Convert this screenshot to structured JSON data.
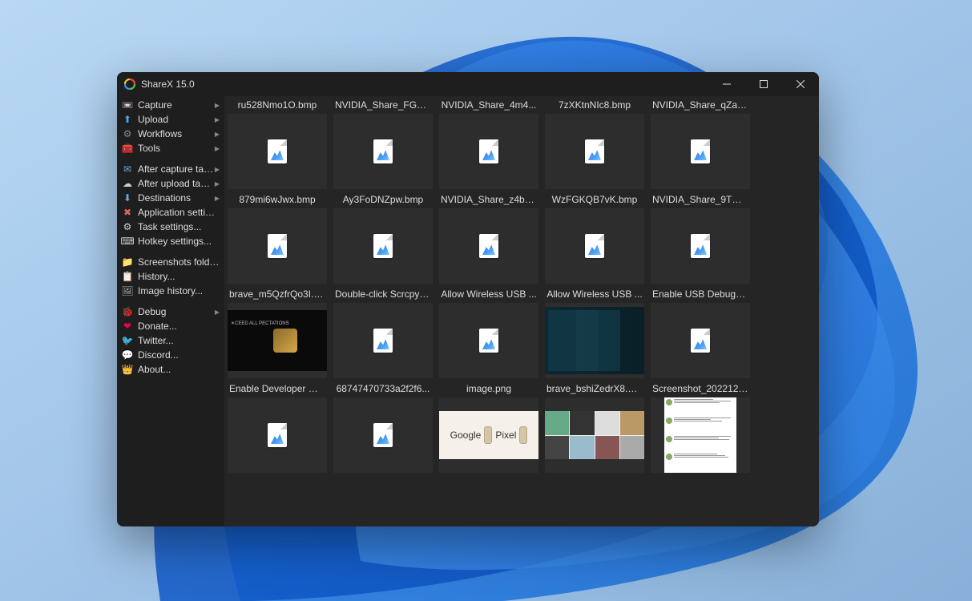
{
  "window": {
    "title": "ShareX 15.0"
  },
  "titlebar": {
    "minimize": "—",
    "maximize": "▢",
    "close": "✕"
  },
  "sidebar": {
    "items": [
      {
        "icon": "📼",
        "label": "Capture",
        "arrow": true
      },
      {
        "icon": "⬆",
        "label": "Upload",
        "arrow": true,
        "iconColor": "#4aa3ff"
      },
      {
        "icon": "⚙",
        "label": "Workflows",
        "arrow": true,
        "iconColor": "#888"
      },
      {
        "icon": "🧰",
        "label": "Tools",
        "arrow": true,
        "iconColor": "#d44"
      },
      {
        "sep": true
      },
      {
        "icon": "✉",
        "label": "After capture tasks",
        "arrow": true,
        "iconColor": "#6ad"
      },
      {
        "icon": "☁",
        "label": "After upload tasks",
        "arrow": true,
        "iconColor": "#ccc"
      },
      {
        "icon": "⬇",
        "label": "Destinations",
        "arrow": true,
        "iconColor": "#6ad"
      },
      {
        "icon": "✖",
        "label": "Application settings...",
        "iconColor": "#d66"
      },
      {
        "icon": "⚙",
        "label": "Task settings...",
        "iconColor": "#ccc"
      },
      {
        "icon": "⌨",
        "label": "Hotkey settings...",
        "iconColor": "#ccc"
      },
      {
        "sep": true
      },
      {
        "icon": "📁",
        "label": "Screenshots folder...",
        "iconColor": "#e8c060"
      },
      {
        "icon": "📋",
        "label": "History...",
        "iconColor": "#aaa"
      },
      {
        "icon": "🖼",
        "label": "Image history...",
        "iconColor": "#aaa"
      },
      {
        "sep": true
      },
      {
        "icon": "🐞",
        "label": "Debug",
        "arrow": true,
        "iconColor": "#c44"
      },
      {
        "icon": "❤",
        "label": "Donate...",
        "iconColor": "#e05"
      },
      {
        "icon": "🐦",
        "label": "Twitter...",
        "iconColor": "#4ab3ff"
      },
      {
        "icon": "💬",
        "label": "Discord...",
        "iconColor": "#7289da"
      },
      {
        "icon": "👑",
        "label": "About...",
        "iconColor": "#e8c060"
      }
    ]
  },
  "files": [
    {
      "name": "ru528Nmo1O.bmp",
      "kind": "placeholder"
    },
    {
      "name": "NVIDIA_Share_FGO...",
      "kind": "placeholder"
    },
    {
      "name": "NVIDIA_Share_4m4...",
      "kind": "placeholder"
    },
    {
      "name": "7zXKtnNIc8.bmp",
      "kind": "placeholder"
    },
    {
      "name": "NVIDIA_Share_qZa6...",
      "kind": "placeholder"
    },
    {
      "name": "879mi6wJwx.bmp",
      "kind": "placeholder"
    },
    {
      "name": "Ay3FoDNZpw.bmp",
      "kind": "placeholder"
    },
    {
      "name": "NVIDIA_Share_z4bc...",
      "kind": "placeholder"
    },
    {
      "name": "WzFGKQB7vK.bmp",
      "kind": "placeholder"
    },
    {
      "name": "NVIDIA_Share_9TW...",
      "kind": "placeholder"
    },
    {
      "name": "brave_m5QzfrQo3I.p...",
      "kind": "dark-ad"
    },
    {
      "name": "Double-click Scrcpy t...",
      "kind": "placeholder"
    },
    {
      "name": "Allow Wireless USB ...",
      "kind": "placeholder"
    },
    {
      "name": "Allow Wireless USB ...",
      "kind": "teal-ui"
    },
    {
      "name": "Enable USB Debuggi...",
      "kind": "placeholder"
    },
    {
      "name": "Enable Developer Op...",
      "kind": "placeholder"
    },
    {
      "name": "68747470733a2f2f6...",
      "kind": "placeholder"
    },
    {
      "name": "image.png",
      "kind": "google-pixel"
    },
    {
      "name": "brave_bshiZedrX8.png",
      "kind": "collage"
    },
    {
      "name": "Screenshot_2022121...",
      "kind": "tweets"
    }
  ],
  "previews": {
    "dark_ad_badge": "✕CEED ALL\nPECTATIONS",
    "google_label": "Google",
    "pixel_label": "Pixel"
  }
}
